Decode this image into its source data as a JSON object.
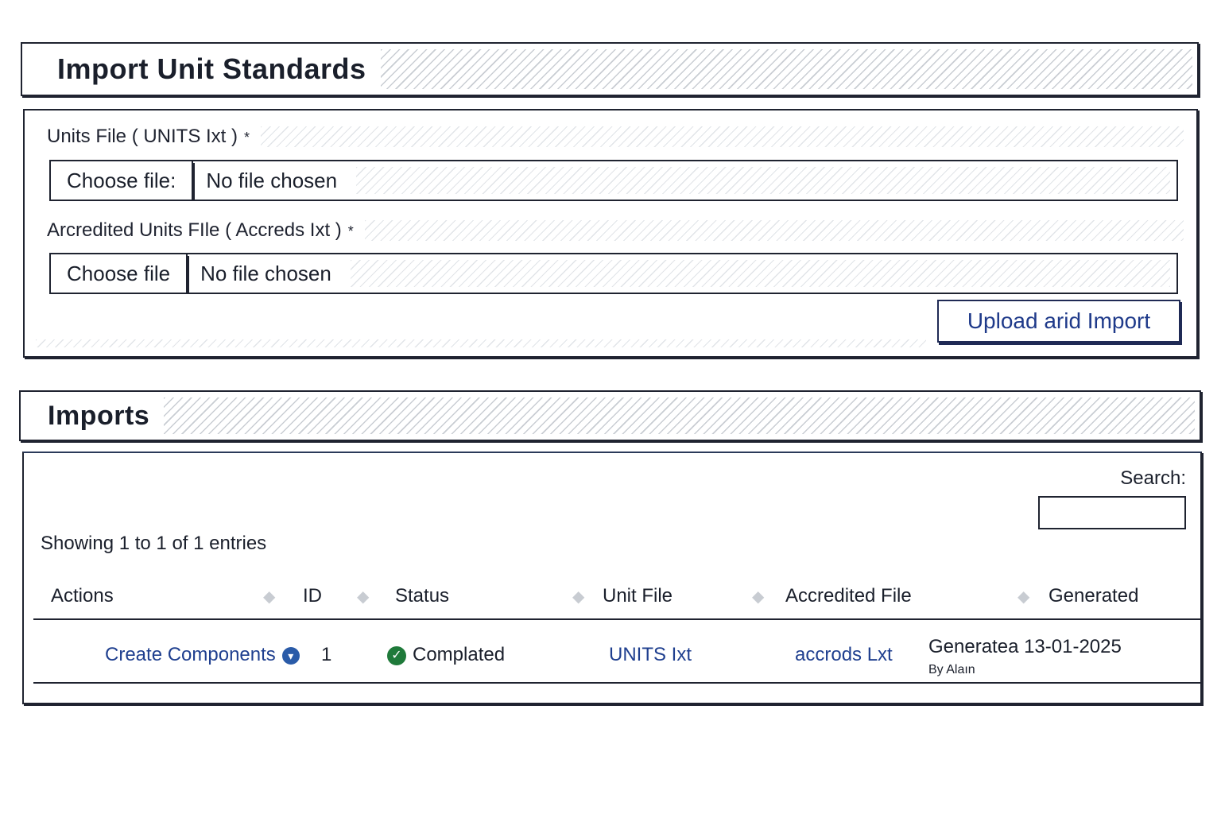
{
  "import_panel": {
    "title": "Import Unit Standards",
    "units_file": {
      "label": "Units File ( UNITS Ixt )",
      "required_mark": "*",
      "button_label": "Choose file:",
      "file_name": "No file chosen"
    },
    "accredited_file": {
      "label": "Arcredited Units FIle ( Accreds Ixt )",
      "required_mark": "*",
      "button_label": "Choose file",
      "file_name": "No file chosen"
    },
    "upload_button": "Upload arid Import"
  },
  "imports_panel": {
    "title": "Imports",
    "search_label": "Search:",
    "search_value": "",
    "showing": "Showing 1 to 1 of 1 entries",
    "columns": [
      "Actions",
      "ID",
      "Status",
      "Unit File",
      "Accredited File",
      "Generated"
    ],
    "rows": [
      {
        "action": "Create Components",
        "action_icon": "info-icon",
        "id": "1",
        "status": "Complated",
        "status_icon": "check-icon",
        "unit_file": "UNITS Ixt",
        "accredited_file": "accrods Lxt",
        "generated": "Generatea 13-01-2025",
        "generated_by": "By Alaın"
      }
    ]
  },
  "colors": {
    "border": "#1f2330",
    "link": "#1f3f8f",
    "success": "#1f7a3a",
    "info": "#2a5ba8"
  }
}
